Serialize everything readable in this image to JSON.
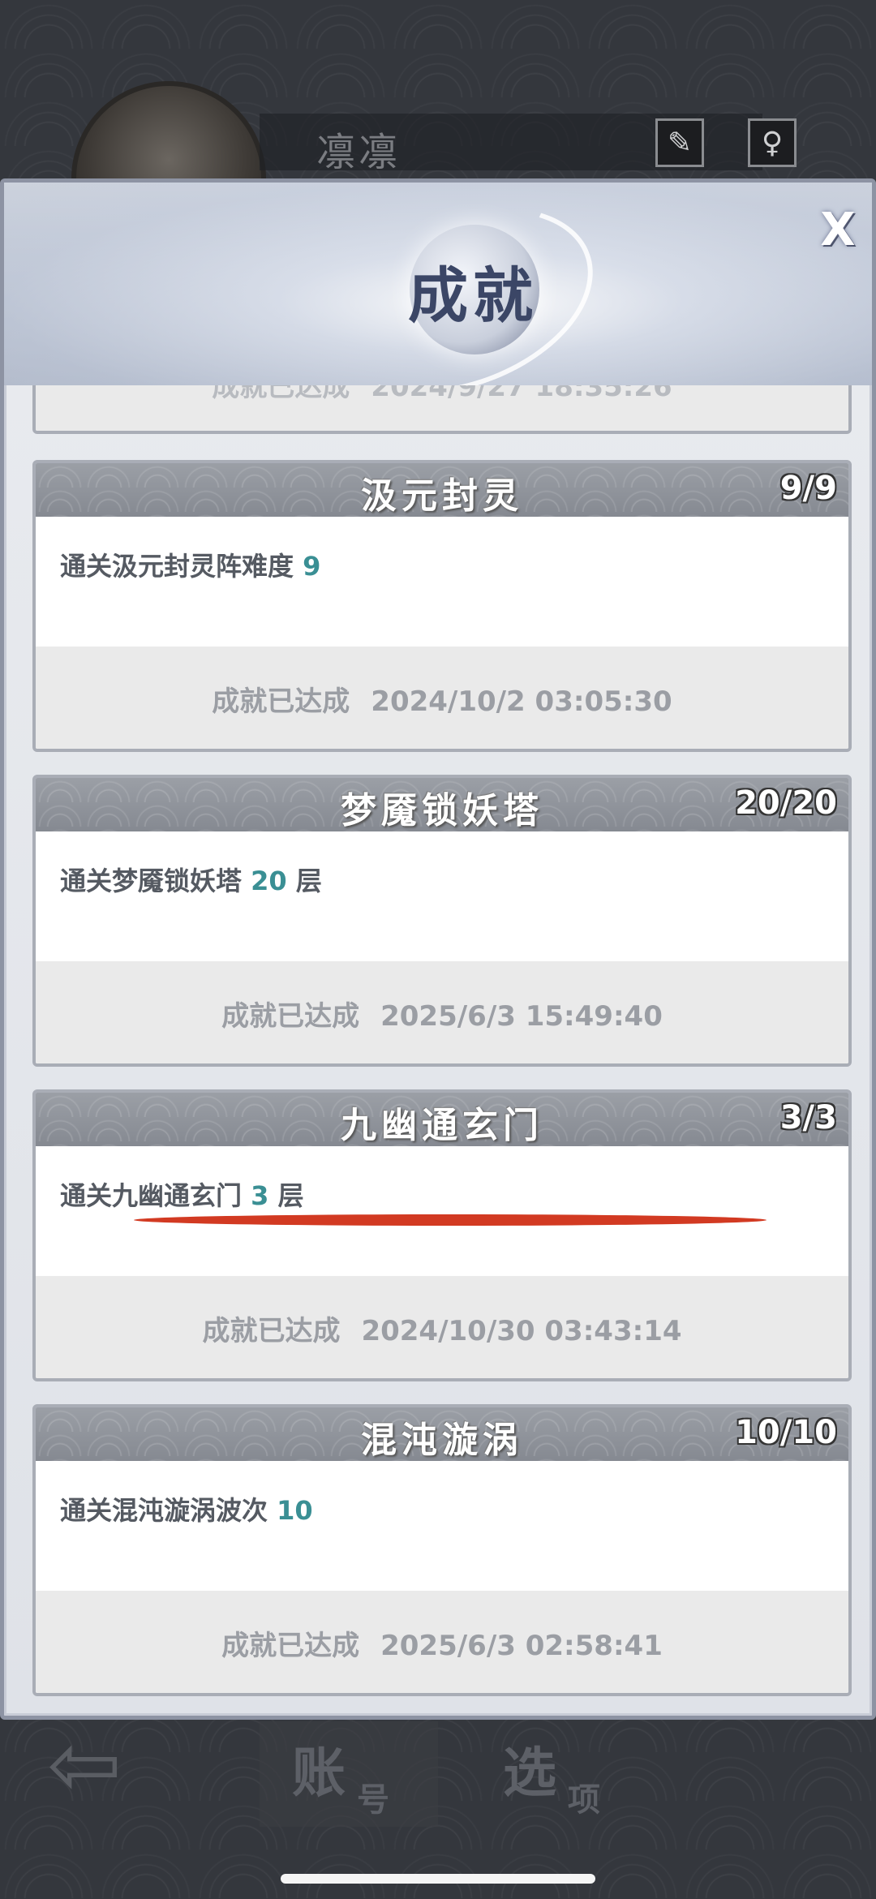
{
  "profile": {
    "name": "凛凛",
    "icon_left": "brush-icon",
    "icon_right": "gender-icon"
  },
  "modal": {
    "title": "成就",
    "close_label": "X"
  },
  "achievements": [
    {
      "title": "",
      "count": "",
      "desc_prefix": "",
      "desc_num": "",
      "desc_suffix": "",
      "status": "成就已达成",
      "time": "2024/9/27 18:35:26"
    },
    {
      "title": "汲元封灵",
      "count": "9/9",
      "desc_prefix": "通关汲元封灵阵难度",
      "desc_num": "9",
      "desc_suffix": "",
      "status": "成就已达成",
      "time": "2024/10/2 03:05:30"
    },
    {
      "title": "梦魇锁妖塔",
      "count": "20/20",
      "desc_prefix": "通关梦魇锁妖塔",
      "desc_num": "20",
      "desc_suffix": "层",
      "status": "成就已达成",
      "time": "2025/6/3 15:49:40"
    },
    {
      "title": "九幽通玄门",
      "count": "3/3",
      "desc_prefix": "通关九幽通玄门",
      "desc_num": "3",
      "desc_suffix": "层",
      "status": "成就已达成",
      "time": "2024/10/30 03:43:14"
    },
    {
      "title": "混沌漩涡",
      "count": "10/10",
      "desc_prefix": "通关混沌漩涡波次",
      "desc_num": "10",
      "desc_suffix": "",
      "status": "成就已达成",
      "time": "2025/6/3 02:58:41"
    }
  ],
  "bottom_bar": {
    "back_icon": "back-arrow-icon",
    "tab_account_big": "账",
    "tab_account_small": "号",
    "tab_options_big": "选",
    "tab_options_small": "项"
  },
  "colors": {
    "accent_number": "#3a8f94",
    "annotation_red": "#d23a22"
  }
}
